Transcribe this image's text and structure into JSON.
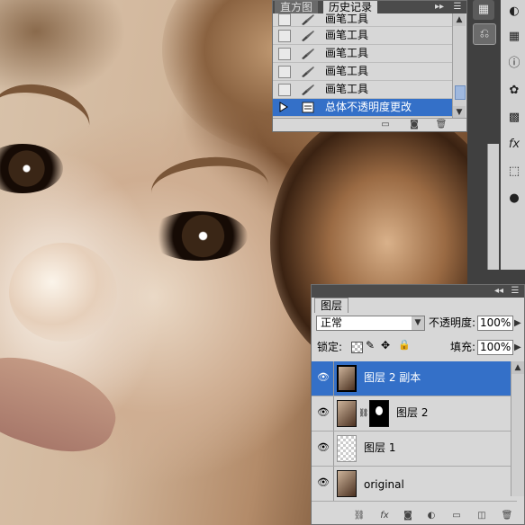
{
  "history_panel": {
    "tabs": [
      "直方图",
      "历史记录"
    ],
    "rows": [
      {
        "label": "画笔工具",
        "icon": "brush-icon",
        "selected": false
      },
      {
        "label": "画笔工具",
        "icon": "brush-icon",
        "selected": false
      },
      {
        "label": "画笔工具",
        "icon": "brush-icon",
        "selected": false
      },
      {
        "label": "画笔工具",
        "icon": "brush-icon",
        "selected": false
      },
      {
        "label": "画笔工具",
        "icon": "brush-icon",
        "selected": false
      },
      {
        "label": "总体不透明度更改",
        "icon": "layer-opacity-icon",
        "selected": true
      }
    ],
    "footer_icons": [
      "new-document-icon",
      "snapshot-icon",
      "trash-icon"
    ]
  },
  "layers_panel": {
    "tab": "图层",
    "blend_mode": "正常",
    "opacity_label": "不透明度:",
    "opacity_value": "100%",
    "lock_label": "锁定:",
    "fill_label": "填充:",
    "fill_value": "100%",
    "layers": [
      {
        "name": "图层 2 副本",
        "selected": true,
        "visible": true,
        "has_mask": false
      },
      {
        "name": "图层 2",
        "selected": false,
        "visible": true,
        "has_mask": true
      },
      {
        "name": "图层 1",
        "selected": false,
        "visible": true,
        "has_mask": false
      },
      {
        "name": "original",
        "selected": false,
        "visible": true,
        "has_mask": false
      }
    ],
    "footer_icons": [
      "link-icon",
      "fx-icon",
      "mask-icon",
      "adjustment-icon",
      "folder-icon",
      "new-layer-icon",
      "trash-icon"
    ]
  },
  "colors": {
    "selection": "#3470c8",
    "panel_bg": "#d7d7d7",
    "tabbar": "#4b4b4b"
  }
}
